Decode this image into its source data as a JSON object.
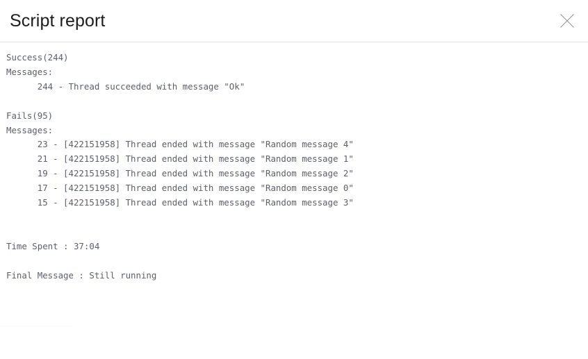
{
  "window": {
    "title": "Script report",
    "close_label": "✕",
    "close_icon": "close-x-icon"
  },
  "report": {
    "success": {
      "heading": "Success(244)",
      "messages_label": "Messages:",
      "entries": [
        "      244 - Thread succeeded with message \"Ok\""
      ]
    },
    "fails": {
      "heading": "Fails(95)",
      "messages_label": "Messages:",
      "entries": [
        "      23 - [422151958] Thread ended with message \"Random message 4\"",
        "      21 - [422151958] Thread ended with message \"Random message 1\"",
        "      19 - [422151958] Thread ended with message \"Random message 2\"",
        "      17 - [422151958] Thread ended with message \"Random message 0\"",
        "      15 - [422151958] Thread ended with message \"Random message 3\""
      ]
    },
    "time_spent": "Time Spent : 37:04",
    "final_message": "Final Message : Still running",
    "lines": [
      "Success(244)",
      "Messages:",
      "      244 - Thread succeeded with message \"Ok\"",
      "",
      "Fails(95)",
      "Messages:",
      "      23 - [422151958] Thread ended with message \"Random message 4\"",
      "      21 - [422151958] Thread ended with message \"Random message 1\"",
      "      19 - [422151958] Thread ended with message \"Random message 2\"",
      "      17 - [422151958] Thread ended with message \"Random message 0\"",
      "      15 - [422151958] Thread ended with message \"Random message 3\"",
      "",
      "",
      "Time Spent : 37:04",
      "",
      "Final Message : Still running"
    ]
  },
  "colors": {
    "background": "#ffffff",
    "title_text": "#1d1d1d",
    "report_text": "#5b5f6b",
    "divider": "#e3e3e3",
    "close_icon": "#9a9a9a"
  }
}
